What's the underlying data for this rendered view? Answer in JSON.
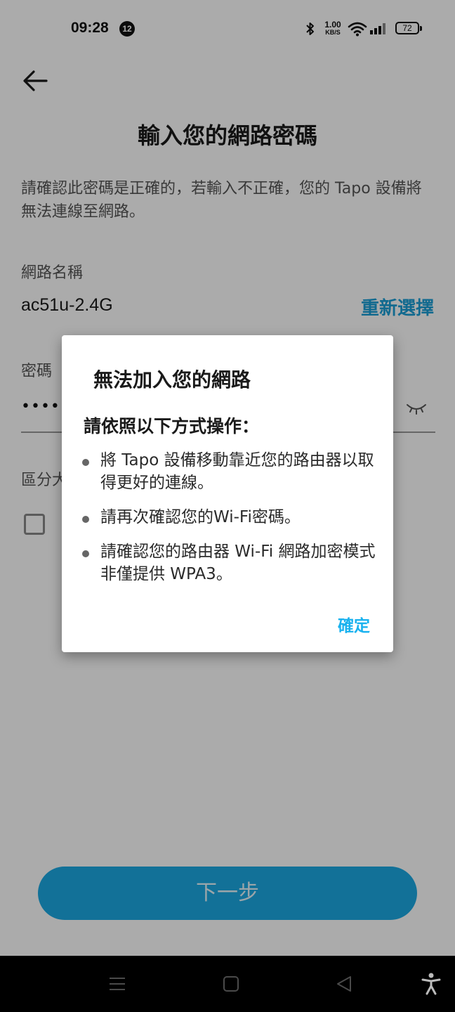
{
  "status_bar": {
    "time": "09:28",
    "notification_count": "12",
    "net_speed_value": "1.00",
    "net_speed_unit": "KB/S",
    "battery": "72"
  },
  "page": {
    "title": "輸入您的網路密碼",
    "description": "請確認此密碼是正確的，若輸入不正確，您的 Tapo 設備將無法連線至網路。",
    "network_name_label": "網路名稱",
    "network_name_value": "ac51u-2.4G",
    "reselect_label": "重新選擇",
    "password_label": "密碼",
    "password_value": "••••••",
    "case_label": "區分大",
    "next_label": "下一步"
  },
  "dialog": {
    "title": "無法加入您的網路",
    "subtitle": "請依照以下方式操作：",
    "items": [
      "將 Tapo 設備移動靠近您的路由器以取得更好的連線。",
      "請再次確認您的Wi-Fi密碼。",
      "請確認您的路由器 Wi-Fi 網路加密模式非僅提供 WPA3。"
    ],
    "ok_label": "確定"
  },
  "colors": {
    "accent": "#1ba9e3",
    "dialog_link": "#1ab2ef"
  },
  "icons": {
    "back": "arrow-left-icon",
    "eye": "eye-closed-icon",
    "nav_menu": "menu-icon",
    "nav_home": "square-home-icon",
    "nav_back": "triangle-back-icon",
    "accessibility": "accessibility-icon"
  }
}
